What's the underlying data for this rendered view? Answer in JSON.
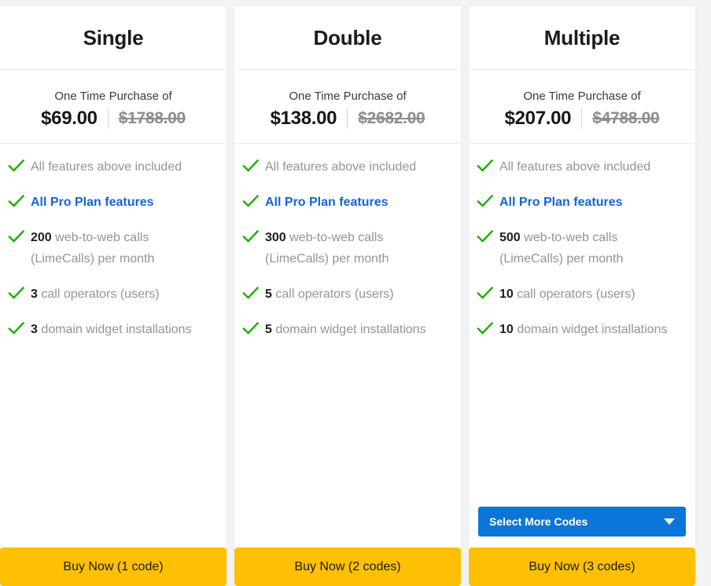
{
  "plans": [
    {
      "name": "Single",
      "price_caption": "One Time Purchase of",
      "price_current": "$69.00",
      "price_old": "$1788.00",
      "features": [
        {
          "qty": "",
          "text": "All features above included",
          "style": "normal"
        },
        {
          "qty": "",
          "text": "All Pro Plan features",
          "style": "pro"
        },
        {
          "qty": "200",
          "text": "web-to-web calls (LimeCalls) per month",
          "style": "normal"
        },
        {
          "qty": "3",
          "text": "call operators (users)",
          "style": "normal"
        },
        {
          "qty": "3",
          "text": "domain widget installations",
          "style": "normal"
        }
      ],
      "select_codes_label": "",
      "has_select_codes": false,
      "buy_label": "Buy Now (1 code)"
    },
    {
      "name": "Double",
      "price_caption": "One Time Purchase of",
      "price_current": "$138.00",
      "price_old": "$2682.00",
      "features": [
        {
          "qty": "",
          "text": "All features above included",
          "style": "normal"
        },
        {
          "qty": "",
          "text": "All Pro Plan features",
          "style": "pro"
        },
        {
          "qty": "300",
          "text": "web-to-web calls (LimeCalls) per month",
          "style": "normal"
        },
        {
          "qty": "5",
          "text": "call operators (users)",
          "style": "normal"
        },
        {
          "qty": "5",
          "text": "domain widget installations",
          "style": "normal"
        }
      ],
      "select_codes_label": "",
      "has_select_codes": false,
      "buy_label": "Buy Now (2 codes)"
    },
    {
      "name": "Multiple",
      "price_caption": "One Time Purchase of",
      "price_current": "$207.00",
      "price_old": "$4788.00",
      "features": [
        {
          "qty": "",
          "text": "All features above included",
          "style": "normal"
        },
        {
          "qty": "",
          "text": "All Pro Plan features",
          "style": "pro"
        },
        {
          "qty": "500",
          "text": "web-to-web calls (LimeCalls) per month",
          "style": "normal"
        },
        {
          "qty": "10",
          "text": "call operators (users)",
          "style": "normal"
        },
        {
          "qty": "10",
          "text": "domain widget installations",
          "style": "normal"
        }
      ],
      "select_codes_label": "Select More Codes",
      "has_select_codes": true,
      "buy_label": "Buy Now (3 codes)"
    }
  ],
  "icons": {
    "check": "check-icon",
    "caret": "chevron-down-icon"
  },
  "colors": {
    "check_green": "#1eaf06",
    "pro_blue": "#1565d8",
    "select_blue": "#0c76d8",
    "buy_yellow": "#ffbf02",
    "page_bg": "#f2f3f4",
    "card_bg": "#ffffff",
    "muted_text": "#949494",
    "strong_text": "#1d1d1d"
  }
}
